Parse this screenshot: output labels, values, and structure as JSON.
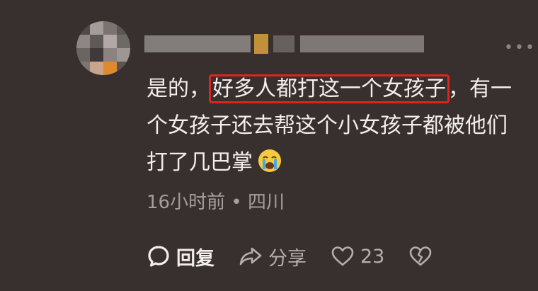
{
  "comment": {
    "prefix": "是的，",
    "highlighted": "好多人都打这一个女孩子",
    "suffix": "，有一个女孩子还去帮这个小女孩子都被他们打了几巴掌"
  },
  "meta": {
    "time": "16小时前",
    "separator": "•",
    "location": "四川"
  },
  "actions": {
    "reply": "回复",
    "share": "分享",
    "likes": "23"
  },
  "icons": {
    "emoji": "crying-face-icon",
    "reply": "comment-bubble-icon",
    "share": "share-arrow-icon",
    "like": "heart-icon",
    "dislike": "broken-heart-icon",
    "more": "more-dots-icon"
  },
  "colors": {
    "background": "#37302f",
    "highlight_border": "#e0231c",
    "text": "#f3eeec",
    "meta_text": "#a59e9b"
  }
}
